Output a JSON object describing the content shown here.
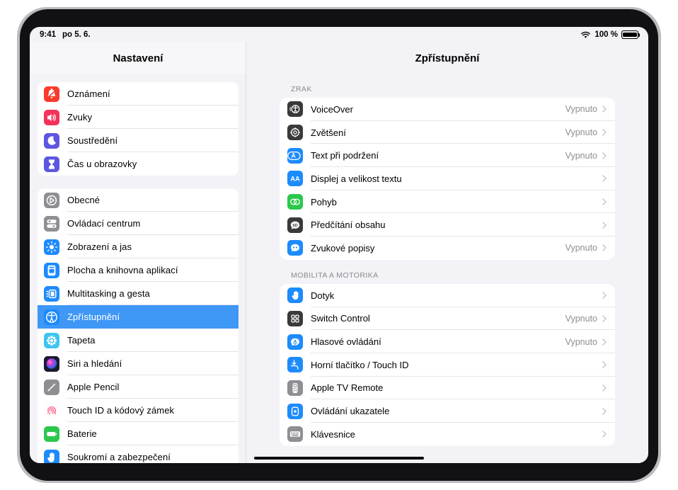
{
  "status": {
    "time": "9:41",
    "date": "po 5. 6.",
    "battery_percent": "100 %",
    "wifi_icon": "wifi-icon",
    "battery_icon": "battery-full-icon"
  },
  "sidebar": {
    "title": "Nastavení",
    "groups": [
      {
        "items": [
          {
            "label": "Oznámení",
            "icon": "bell-icon",
            "selected": false
          },
          {
            "label": "Zvuky",
            "icon": "speaker-icon",
            "selected": false
          },
          {
            "label": "Soustředění",
            "icon": "moon-icon",
            "selected": false
          },
          {
            "label": "Čas u obrazovky",
            "icon": "hourglass-icon",
            "selected": false
          }
        ]
      },
      {
        "items": [
          {
            "label": "Obecné",
            "icon": "gear-icon",
            "selected": false
          },
          {
            "label": "Ovládací centrum",
            "icon": "sliders-icon",
            "selected": false
          },
          {
            "label": "Zobrazení a jas",
            "icon": "brightness-icon",
            "selected": false
          },
          {
            "label": "Plocha a knihovna aplikací",
            "icon": "home-screen-icon",
            "selected": false
          },
          {
            "label": "Multitasking a gesta",
            "icon": "multitasking-icon",
            "selected": false
          },
          {
            "label": "Zpřístupnění",
            "icon": "accessibility-icon",
            "selected": true
          },
          {
            "label": "Tapeta",
            "icon": "wallpaper-icon",
            "selected": false
          },
          {
            "label": "Siri a hledání",
            "icon": "siri-icon",
            "selected": false
          },
          {
            "label": "Apple Pencil",
            "icon": "pencil-icon",
            "selected": false
          },
          {
            "label": "Touch ID a kódový zámek",
            "icon": "fingerprint-icon",
            "selected": false
          },
          {
            "label": "Baterie",
            "icon": "battery-icon",
            "selected": false
          },
          {
            "label": "Soukromí a zabezpečení",
            "icon": "hand-raised-icon",
            "selected": false
          }
        ]
      }
    ]
  },
  "detail": {
    "title": "Zpřístupnění",
    "sections": [
      {
        "header": "ZRAK",
        "rows": [
          {
            "label": "VoiceOver",
            "value": "Vypnuto",
            "icon": "voiceover-icon"
          },
          {
            "label": "Zvětšení",
            "value": "Vypnuto",
            "icon": "zoom-icon"
          },
          {
            "label": "Text při podržení",
            "value": "Vypnuto",
            "icon": "hover-text-icon"
          },
          {
            "label": "Displej a velikost textu",
            "value": "",
            "icon": "text-size-icon"
          },
          {
            "label": "Pohyb",
            "value": "",
            "icon": "motion-icon"
          },
          {
            "label": "Předčítání obsahu",
            "value": "",
            "icon": "spoken-content-icon"
          },
          {
            "label": "Zvukové popisy",
            "value": "Vypnuto",
            "icon": "audio-descriptions-icon"
          }
        ]
      },
      {
        "header": "MOBILITA A MOTORIKA",
        "rows": [
          {
            "label": "Dotyk",
            "value": "",
            "icon": "touch-icon"
          },
          {
            "label": "Switch Control",
            "value": "Vypnuto",
            "icon": "switch-control-icon"
          },
          {
            "label": "Hlasové ovládání",
            "value": "Vypnuto",
            "icon": "voice-control-icon"
          },
          {
            "label": "Horní tlačítko / Touch ID",
            "value": "",
            "icon": "top-button-icon"
          },
          {
            "label": "Apple TV Remote",
            "value": "",
            "icon": "apple-tv-remote-icon"
          },
          {
            "label": "Ovládání ukazatele",
            "value": "",
            "icon": "pointer-control-icon"
          },
          {
            "label": "Klávesnice",
            "value": "",
            "icon": "keyboard-icon"
          }
        ]
      }
    ]
  },
  "colors": {
    "accent": "#3f97f6",
    "sidebar_bg": "#f2f2f7",
    "card_bg": "#ffffff",
    "value_text": "#8e8e93"
  }
}
